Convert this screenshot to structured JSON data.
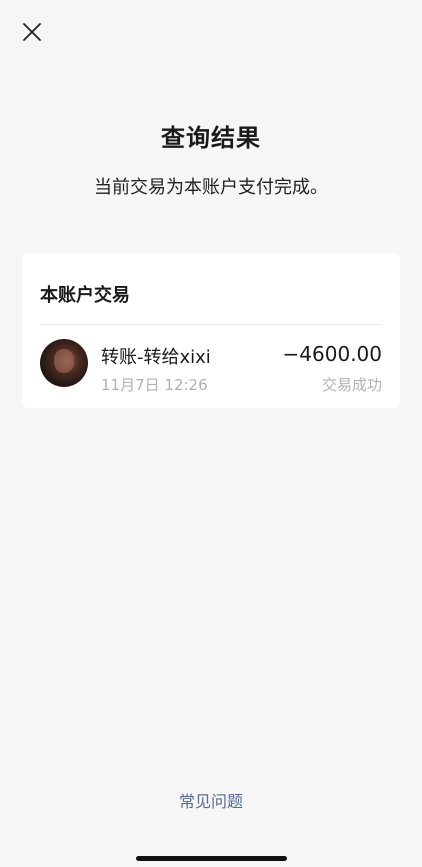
{
  "header": {
    "close_icon": "close-icon"
  },
  "result": {
    "title": "查询结果",
    "subtitle": "当前交易为本账户支付完成。"
  },
  "card": {
    "title": "本账户交易",
    "transaction": {
      "avatar_icon": "avatar",
      "name": "转账-转给xixi",
      "time": "11月7日 12:26",
      "amount": "−4600.00",
      "status": "交易成功"
    }
  },
  "footer": {
    "faq_label": "常见问题"
  },
  "colors": {
    "background": "#f6f6f6",
    "card": "#ffffff",
    "link": "#576b95",
    "secondary_text": "#b2b2b2"
  }
}
